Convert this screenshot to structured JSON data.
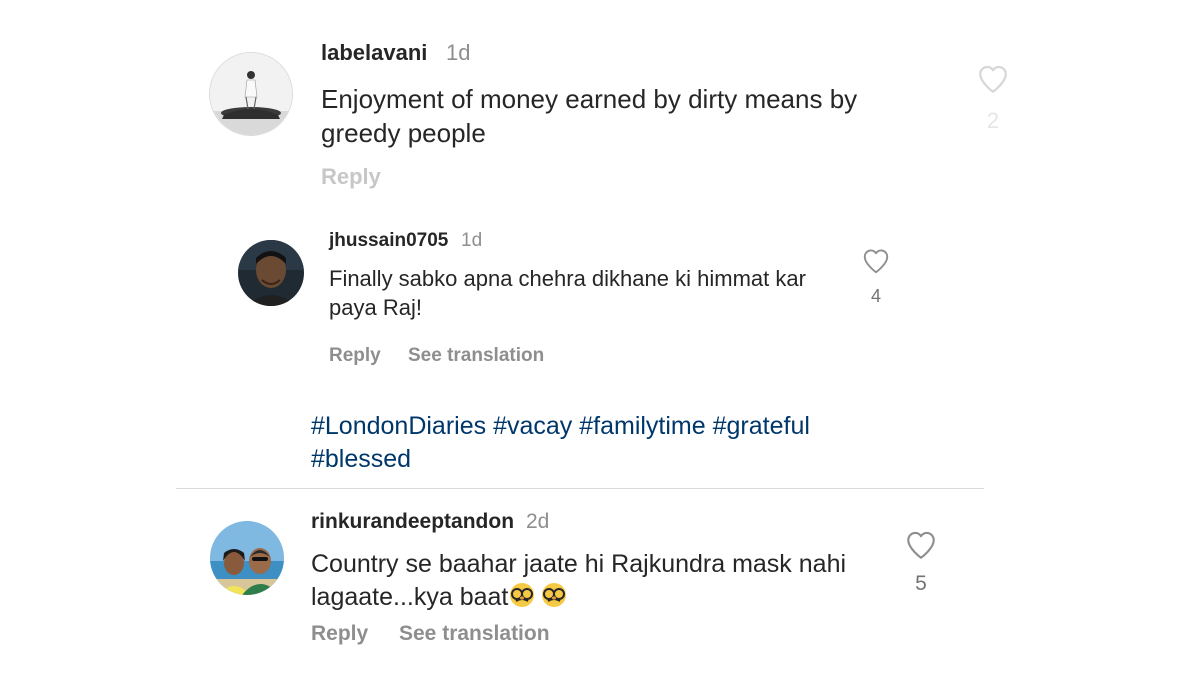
{
  "comments": [
    {
      "username": "labelavani",
      "time": "1d",
      "text": "Enjoyment of money earned by dirty means by greedy people",
      "reply_label": "Reply",
      "likes": "2",
      "faded_likes": true
    },
    {
      "username": "jhussain0705",
      "time": "1d",
      "text": "Finally sabko apna chehra dikhane ki himmat kar paya Raj!",
      "reply_label": "Reply",
      "translate_label": "See translation",
      "likes": "4"
    },
    {
      "username": "rinkurandeeptandon",
      "time": "2d",
      "text": "Country se baahar jaate hi Rajkundra mask nahi lagaate...kya baat",
      "emoji": "🥸🥸",
      "reply_label": "Reply",
      "translate_label": "See translation",
      "likes": "5"
    }
  ],
  "hashtags": {
    "line1": [
      "#LondonDiaries",
      "#vacay",
      "#familytime",
      "#grateful"
    ],
    "line2": [
      "#blessed"
    ]
  },
  "colors": {
    "hashtag": "#00376b",
    "secondary_text": "#8e8e8e",
    "primary_text": "#262626",
    "divider": "#dbdbdb"
  },
  "icons": [
    "heart-outline-icon",
    "disguise-face-emoji"
  ]
}
